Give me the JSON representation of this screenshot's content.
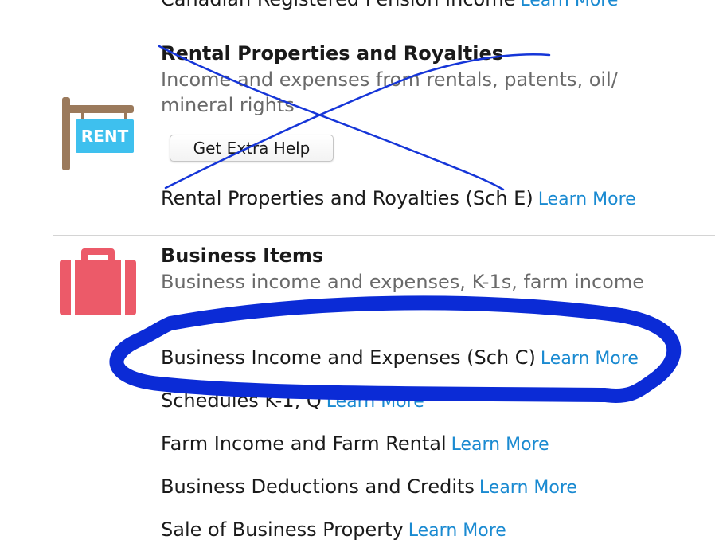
{
  "top_row": {
    "label": "Canadian Registered Pension Income",
    "learn_more": "Learn More"
  },
  "rental": {
    "title": "Rental Properties and Royalties",
    "description": "Income and expenses from rentals, patents, oil/ mineral rights",
    "icon_label": "RENT",
    "extra_help_button": "Get Extra Help",
    "items": [
      {
        "label": "Rental Properties and Royalties (Sch E)",
        "learn_more": "Learn More"
      }
    ]
  },
  "business": {
    "title": "Business Items",
    "description": "Business income and expenses, K-1s, farm income",
    "items": [
      {
        "label": "Business Income and Expenses (Sch C)",
        "learn_more": "Learn More"
      },
      {
        "label": "Schedules K-1, Q",
        "learn_more": "Learn More"
      },
      {
        "label": "Farm Income and Farm Rental",
        "learn_more": "Learn More"
      },
      {
        "label": "Business Deductions and Credits",
        "learn_more": "Learn More"
      },
      {
        "label": "Sale of Business Property",
        "learn_more": "Learn More"
      }
    ]
  },
  "colors": {
    "link": "#1a8ad1",
    "rent_sign": "#3ec0ee",
    "sign_post": "#9b7a5c",
    "briefcase": "#ec5a69",
    "annotation_ink": "#0b2bd6"
  }
}
